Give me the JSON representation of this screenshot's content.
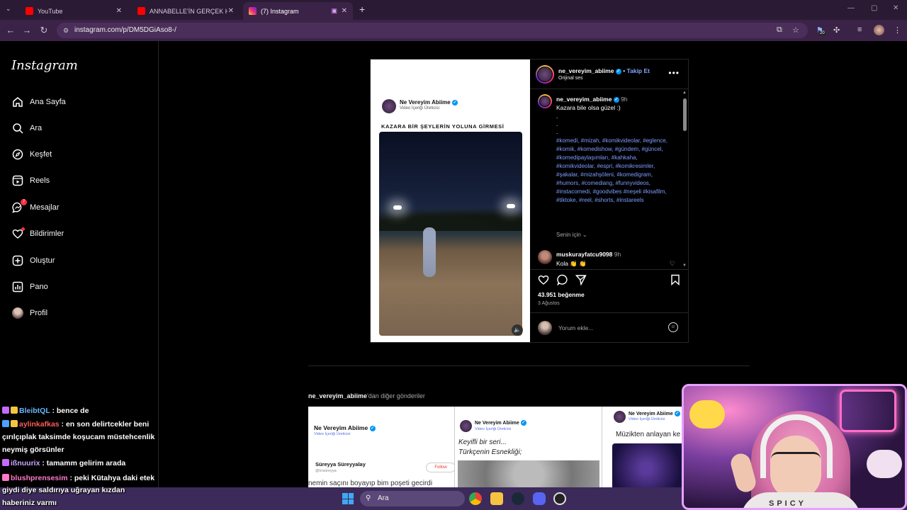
{
  "browser": {
    "tabs": [
      {
        "title": "YouTube",
        "color": "#ff0000"
      },
      {
        "title": "ANNABELLE'İN GERÇEK HİKAYE",
        "color": "#ff0000"
      },
      {
        "title": "(7) Instagram",
        "color": "#e1306c"
      }
    ],
    "url": "instagram.com/p/DM5DGiAso8-/",
    "ext_badge": "20"
  },
  "sidebar": {
    "logo": "Instagram",
    "items": [
      {
        "label": "Ana Sayfa",
        "icon": "home-icon"
      },
      {
        "label": "Ara",
        "icon": "search-icon"
      },
      {
        "label": "Keşfet",
        "icon": "compass-icon"
      },
      {
        "label": "Reels",
        "icon": "reels-icon"
      },
      {
        "label": "Mesajlar",
        "icon": "messenger-icon",
        "badge": "7"
      },
      {
        "label": "Bildirimler",
        "icon": "heart-icon"
      },
      {
        "label": "Oluştur",
        "icon": "plus-square-icon"
      },
      {
        "label": "Pano",
        "icon": "dashboard-icon"
      },
      {
        "label": "Profil",
        "icon": "profile-avatar"
      }
    ]
  },
  "post": {
    "media": {
      "account_name": "Ne Vereyim Abiime",
      "account_sub": "Video İçeriği Üreticisi",
      "headline": "KAZARA BİR ŞEYLERİN YOLUNA GİRMESİ"
    },
    "header": {
      "username": "ne_vereyim_abiime",
      "follow": "Takip Et",
      "audio": "Orijinal ses"
    },
    "caption": {
      "username": "ne_vereyim_abiime",
      "time": "9h",
      "text": "Kazara bile olsa güzel :)",
      "dots": [
        ".",
        ".",
        "."
      ],
      "hashtags": "#komedi, #mizah, #komikvideolar, #eglence, #komik, #komedishow, #gündem, #güncel, #komedipaylaşımları, #kahkaha, #komikvideolar, #espri, #komikresimler, #şakalar, #mizahşöleni, #komedigram, #humors, #comediang, #funnyvideos, #instacomedi, #goodvibes #neşeli #kisafilm, #tiktoke, #reel, #shorts, #instareels",
      "see_for": "Senin için"
    },
    "comment": {
      "username": "muskurayfatcu9098",
      "time": "9h",
      "text": "Kola 👏 👏"
    },
    "likes": "43.951 beğenme",
    "date": "3 Ağustos",
    "add_comment_placeholder": "Yorum ekle..."
  },
  "more_posts": {
    "username": "ne_vereyim_abiime",
    "suffix": "'dan diğer gönderiler",
    "thumbs": [
      {
        "name": "Ne Vereyim Abiime",
        "sub": "Video İçeriği Üreticisi",
        "line1": "Süreyya Süreyyalay",
        "line2": "@tırsüreyya",
        "follow": "Follow",
        "line3": "nemin saçını boyayıp bim poşeti gecirdi"
      },
      {
        "name": "Ne Vereyim Abiime",
        "sub": "Video İçeriği Üreticisi",
        "line1": "Keyifli bir seri...",
        "line2": "Türkçenin Esnekliği;"
      },
      {
        "name": "Ne Vereyim Abiime",
        "sub": "Video İçeriği Üreticisi",
        "line1": "Müzikten anlayan ke"
      }
    ]
  },
  "chat": [
    {
      "user": "BleibtQL",
      "user_color": "#6ab7ff",
      "text": ": bence de"
    },
    {
      "user": "aylinkafkas",
      "user_color": "#ff5a5a",
      "text": ": en son delirtcekler beni"
    },
    {
      "text": "çırılçıplak taksimde koşucam müstehcenlik"
    },
    {
      "text": "neymiş görsünler"
    },
    {
      "user": "ißnuurix",
      "user_color": "#c9a6ff",
      "text": ": tamamm gelirim arada"
    },
    {
      "user": "blushprensesim",
      "user_color": "#ff7ac6",
      "text": ": peki Kütahya daki etek"
    },
    {
      "text": "giydi diye saldırıya uğrayan kızdan"
    },
    {
      "text": "haberiniz varmı"
    }
  ],
  "taskbar": {
    "search": "Ara"
  },
  "webcam": {
    "shirt_text": "SPICY"
  }
}
